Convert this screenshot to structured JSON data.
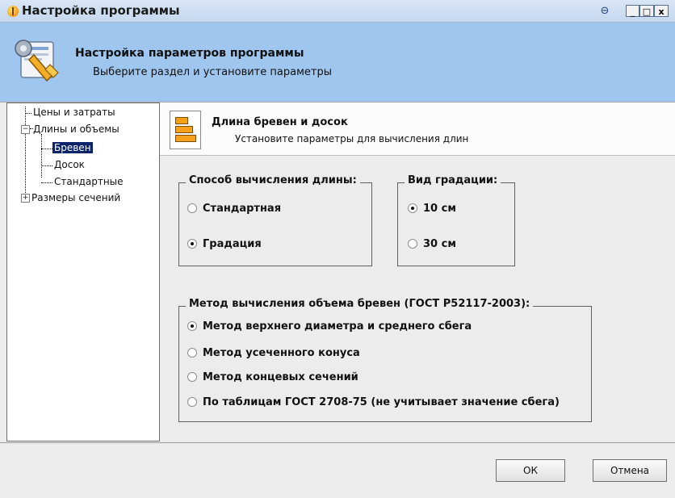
{
  "window": {
    "title": "Настройка программы",
    "buttons": {
      "pin": "⊖",
      "minimize": "_",
      "maximize": "□",
      "close": "x"
    }
  },
  "header": {
    "title": "Настройка параметров программы",
    "subtitle": "Выберите раздел и установите параметры"
  },
  "tree": {
    "items": [
      {
        "label": "Цены и затраты"
      },
      {
        "label": "Длины и объемы",
        "expanded": true
      },
      {
        "label": "Бревен",
        "selected": true
      },
      {
        "label": "Досок"
      },
      {
        "label": "Стандартные"
      },
      {
        "label": "Размеры сечений",
        "expanded": false
      }
    ]
  },
  "section": {
    "title": "Длина бревен и досок",
    "subtitle": "Установите параметры для вычисления длин"
  },
  "length_method": {
    "title": "Способ вычисления длины:",
    "options": [
      {
        "label": "Стандартная",
        "checked": false
      },
      {
        "label": "Градация",
        "checked": true
      }
    ]
  },
  "gradation": {
    "title": "Вид градации:",
    "options": [
      {
        "label": "10 см",
        "checked": true
      },
      {
        "label": "30 см",
        "checked": false
      }
    ]
  },
  "volume_method": {
    "title": "Метод вычисления объема бревен (ГОСТ Р52117-2003):",
    "options": [
      {
        "label": "Метод верхнего диаметра и среднего сбега",
        "checked": true
      },
      {
        "label": "Метод усеченного конуса",
        "checked": false
      },
      {
        "label": "Метод концевых сечений",
        "checked": false
      },
      {
        "label": "По таблицам ГОСТ 2708-75  (не учитывает значение сбега)",
        "checked": false
      }
    ]
  },
  "footer": {
    "ok_label": "ОК",
    "cancel_label": "Отмена"
  },
  "colors": {
    "header_bg": "#9fc6ef",
    "selection": "#0b246a",
    "icon_orange": "#f7a11a"
  }
}
